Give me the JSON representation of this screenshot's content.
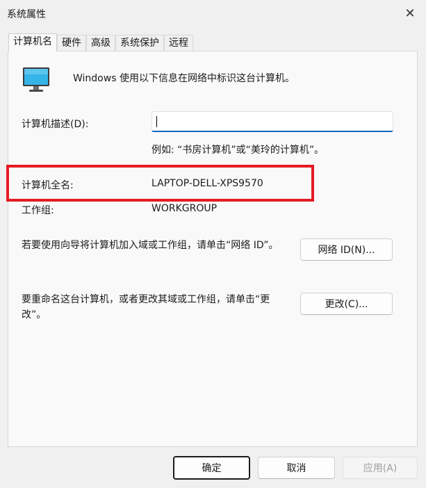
{
  "window": {
    "title": "系统属性",
    "close_glyph": "✕"
  },
  "tabs": [
    {
      "label": "计算机名",
      "active": true
    },
    {
      "label": "硬件"
    },
    {
      "label": "高级"
    },
    {
      "label": "系统保护"
    },
    {
      "label": "远程"
    }
  ],
  "panel": {
    "intro": "Windows 使用以下信息在网络中标识这台计算机。",
    "description_label": "计算机描述(D):",
    "description_value": "",
    "description_example": "例如: “书房计算机”或“美玲的计算机”。",
    "full_name_label": "计算机全名:",
    "full_name_value": "LAPTOP-DELL-XPS9570",
    "workgroup_label": "工作组:",
    "workgroup_value": "WORKGROUP",
    "network_id_text": "若要使用向导将计算机加入域或工作组，请单击“网络 ID”。",
    "network_id_button": "网络 ID(N)...",
    "rename_text": "要重命名这台计算机，或者更改其域或工作组，请单击“更改”。",
    "change_button": "更改(C)..."
  },
  "footer": {
    "ok": "确定",
    "cancel": "取消",
    "apply": "应用(A)"
  },
  "icons": {
    "monitor": "monitor-icon",
    "close": "close-icon"
  },
  "colors": {
    "highlight": "#e51c24",
    "accent": "#0067c0"
  }
}
